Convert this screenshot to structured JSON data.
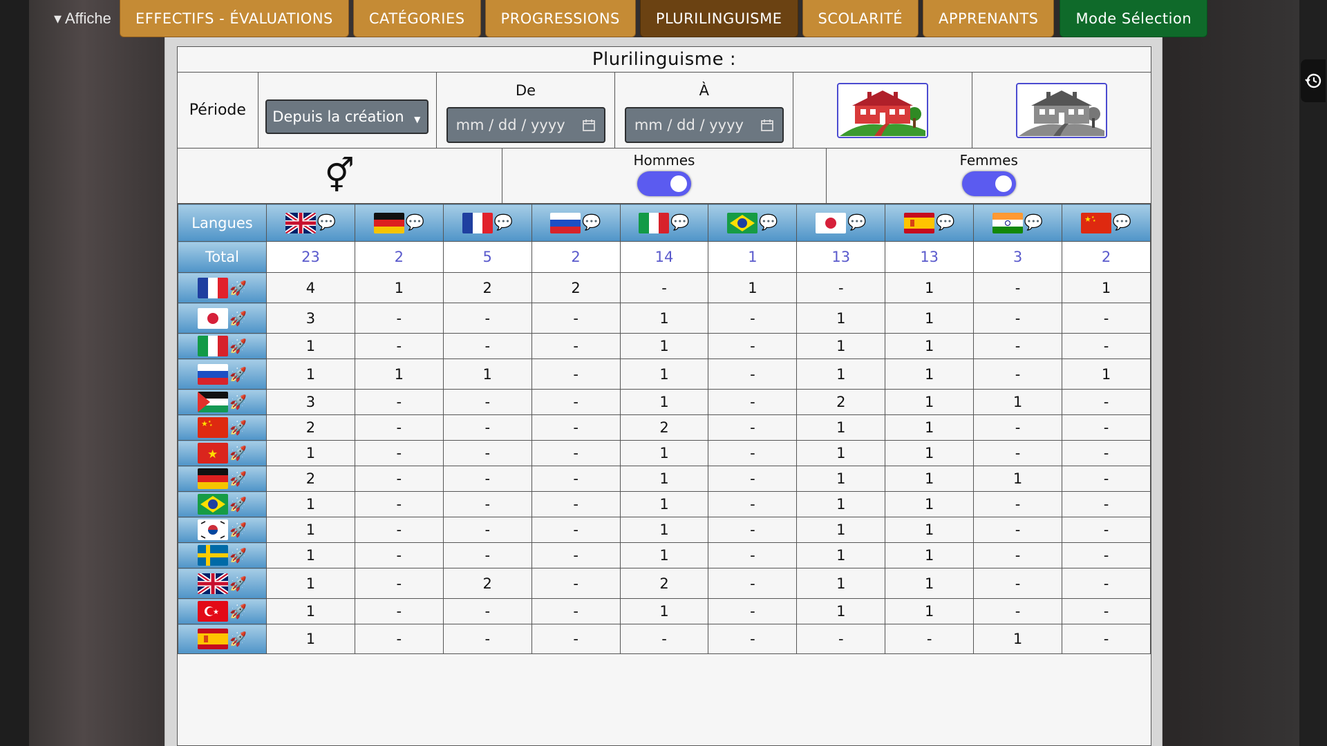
{
  "top": {
    "affiche_label": "▾ Affiche",
    "tabs": [
      {
        "label": "EFFECTIFS - ÉVALUATIONS",
        "state": "normal"
      },
      {
        "label": "CATÉGORIES",
        "state": "normal"
      },
      {
        "label": "PROGRESSIONS",
        "state": "normal"
      },
      {
        "label": "PLURILINGUISME",
        "state": "active"
      },
      {
        "label": "SCOLARITÉ",
        "state": "normal"
      },
      {
        "label": "APPRENANTS",
        "state": "normal"
      },
      {
        "label": "Mode Sélection",
        "state": "green"
      }
    ]
  },
  "panel": {
    "title": "Plurilinguisme :",
    "period": {
      "label": "Période",
      "select_value": "Depuis la création",
      "from_label": "De",
      "to_label": "À",
      "from_placeholder": "mm / dd / yyyy",
      "to_placeholder": "mm / dd / yyyy"
    },
    "gender": {
      "symbol": "⚥",
      "men_label": "Hommes",
      "women_label": "Femmes",
      "men_on": true,
      "women_on": true
    },
    "table": {
      "header_label": "Langues",
      "total_label": "Total",
      "columns": [
        "gb",
        "de",
        "fr",
        "ru",
        "it",
        "br",
        "jp",
        "es",
        "in",
        "cn"
      ],
      "totals": [
        "23",
        "2",
        "5",
        "2",
        "14",
        "1",
        "13",
        "13",
        "3",
        "2"
      ],
      "rows": [
        {
          "flag": "fr",
          "values": [
            "4",
            "1",
            "2",
            "2",
            "-",
            "1",
            "-",
            "1",
            "-",
            "1"
          ]
        },
        {
          "flag": "jp",
          "values": [
            "3",
            "-",
            "-",
            "-",
            "1",
            "-",
            "1",
            "1",
            "-",
            "-"
          ]
        },
        {
          "flag": "it",
          "values": [
            "1",
            "-",
            "-",
            "-",
            "1",
            "-",
            "1",
            "1",
            "-",
            "-"
          ]
        },
        {
          "flag": "ru",
          "values": [
            "1",
            "1",
            "1",
            "-",
            "1",
            "-",
            "1",
            "1",
            "-",
            "1"
          ]
        },
        {
          "flag": "ps",
          "values": [
            "3",
            "-",
            "-",
            "-",
            "1",
            "-",
            "2",
            "1",
            "1",
            "-"
          ]
        },
        {
          "flag": "cn",
          "values": [
            "2",
            "-",
            "-",
            "-",
            "2",
            "-",
            "1",
            "1",
            "-",
            "-"
          ]
        },
        {
          "flag": "vn",
          "values": [
            "1",
            "-",
            "-",
            "-",
            "1",
            "-",
            "1",
            "1",
            "-",
            "-"
          ]
        },
        {
          "flag": "de",
          "values": [
            "2",
            "-",
            "-",
            "-",
            "1",
            "-",
            "1",
            "1",
            "1",
            "-"
          ]
        },
        {
          "flag": "br",
          "values": [
            "1",
            "-",
            "-",
            "-",
            "1",
            "-",
            "1",
            "1",
            "-",
            "-"
          ]
        },
        {
          "flag": "kr",
          "values": [
            "1",
            "-",
            "-",
            "-",
            "1",
            "-",
            "1",
            "1",
            "-",
            "-"
          ]
        },
        {
          "flag": "se",
          "values": [
            "1",
            "-",
            "-",
            "-",
            "1",
            "-",
            "1",
            "1",
            "-",
            "-"
          ]
        },
        {
          "flag": "gb",
          "values": [
            "1",
            "-",
            "2",
            "-",
            "2",
            "-",
            "1",
            "1",
            "-",
            "-"
          ]
        },
        {
          "flag": "tr",
          "values": [
            "1",
            "-",
            "-",
            "-",
            "1",
            "-",
            "1",
            "1",
            "-",
            "-"
          ]
        },
        {
          "flag": "es",
          "values": [
            "1",
            "-",
            "-",
            "-",
            "-",
            "-",
            "-",
            "-",
            "1",
            "-"
          ]
        }
      ]
    }
  },
  "colors": {
    "tab_normal": "#c58b35",
    "tab_active": "#6b4212",
    "tab_green": "#0f6a2a",
    "header_blue": "#4f94c8",
    "toggle": "#5b5bf0",
    "total_text": "#5a5acc"
  },
  "icons": {
    "history": "history-icon",
    "bubble": "speech-bubble-icon",
    "rocket": "rocket-icon",
    "calendar": "calendar-icon",
    "house_color": "red-house-icon",
    "house_gray": "gray-house-icon"
  }
}
